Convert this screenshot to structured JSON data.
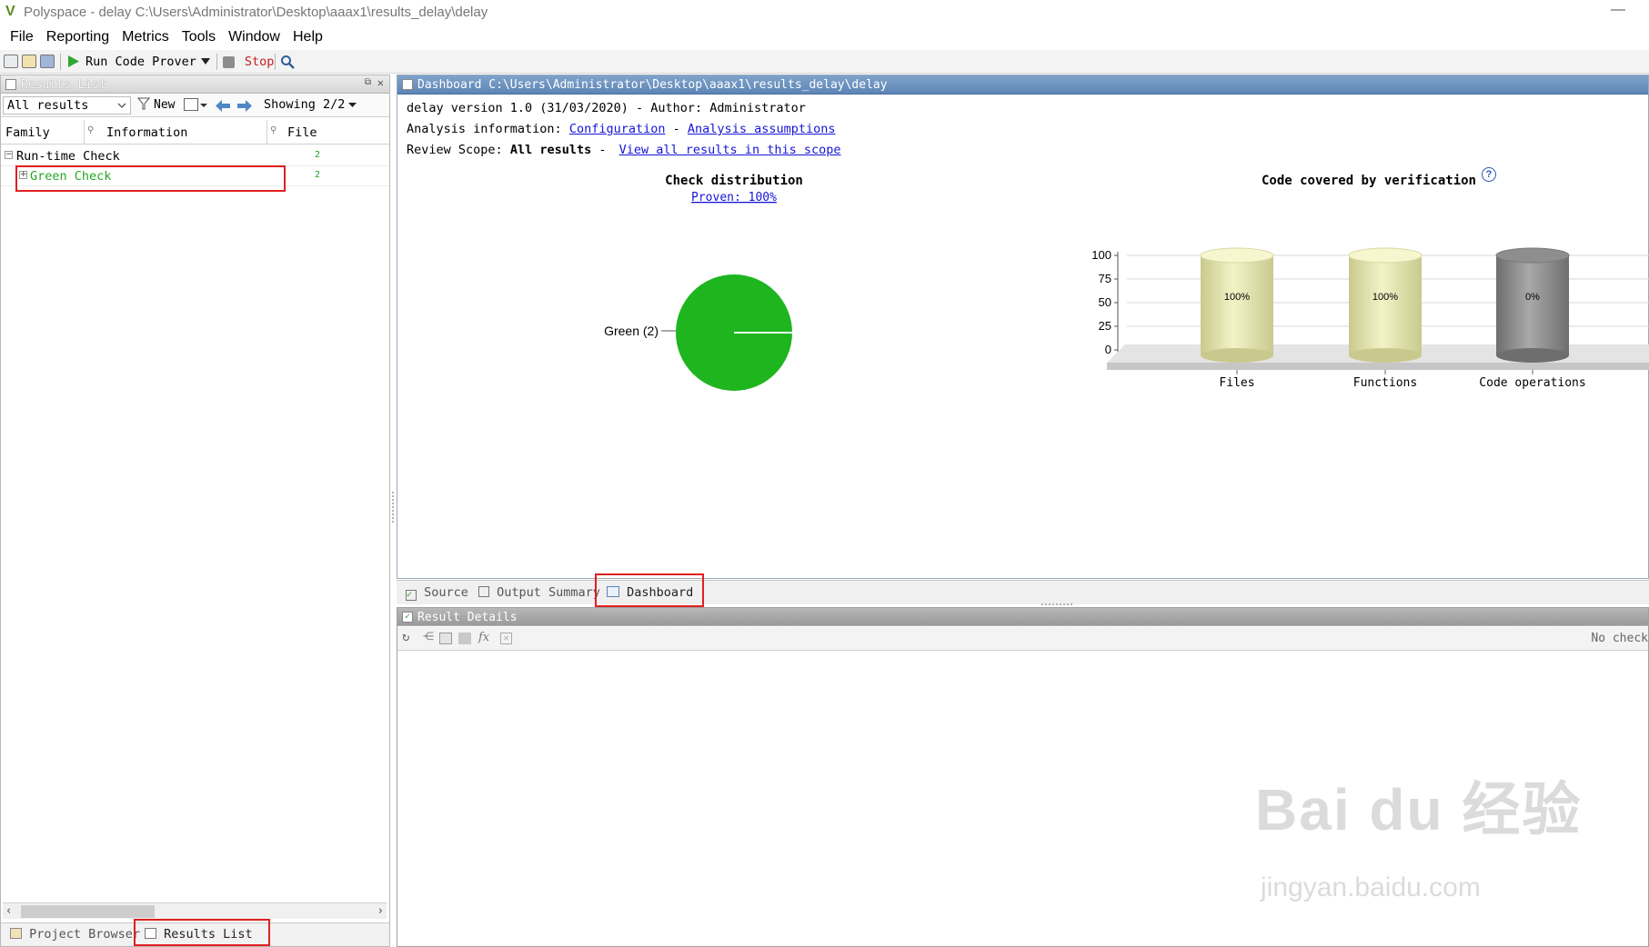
{
  "window": {
    "title": "Polyspace - delay C:\\Users\\Administrator\\Desktop\\aaax1\\results_delay\\delay",
    "logo": "V",
    "minimize": "—"
  },
  "menu": [
    "File",
    "Reporting",
    "Metrics",
    "Tools",
    "Window",
    "Help"
  ],
  "toolbar": {
    "run_label": "Run Code Prover",
    "stop_label": "Stop"
  },
  "results_list": {
    "title": "Results List",
    "filter": "All results",
    "new_label": "New",
    "showing": "Showing 2/2",
    "columns": [
      "Family",
      "Information",
      "File"
    ],
    "rows": [
      {
        "label": "Run-time Check",
        "count": "2",
        "expander": "−"
      },
      {
        "label": "Green Check",
        "count": "2",
        "expander": "+"
      }
    ],
    "bottom_tabs": [
      "Project Browser",
      "Results List"
    ]
  },
  "dashboard": {
    "title": "Dashboard C:\\Users\\Administrator\\Desktop\\aaax1\\results_delay\\delay",
    "version_line": "delay version 1.0 (31/03/2020) - Author: Administrator",
    "analysis_prefix": "Analysis information:",
    "analysis_link1": "Configuration",
    "analysis_sep": "-",
    "analysis_link2": "Analysis assumptions",
    "scope_prefix": "Review Scope:",
    "scope_value": "All results",
    "scope_sep": "-",
    "scope_link": "View all results in this scope",
    "help_icon": "?"
  },
  "view_tabs": [
    "Source",
    "Output Summary",
    "Dashboard"
  ],
  "result_details": {
    "title": "Result Details",
    "fx": "fx",
    "status": "No check"
  },
  "watermark": {
    "main": "Bai du 经验",
    "sub": "jingyan.baidu.com"
  },
  "chart_data": [
    {
      "type": "pie",
      "title": "Check distribution",
      "subtitle": "Proven: 100%",
      "slices": [
        {
          "label": "Green (2)",
          "value": 2,
          "color": "#1eb51e"
        }
      ]
    },
    {
      "type": "bar",
      "title": "Code covered by verification",
      "categories": [
        "Files",
        "Functions",
        "Code operations"
      ],
      "values": [
        100,
        100,
        0
      ],
      "data_labels": [
        "100%",
        "100%",
        "0%"
      ],
      "ylim": [
        0,
        100
      ],
      "yticks": [
        "100",
        "75",
        "50",
        "25",
        "0"
      ],
      "grid": true,
      "colors": [
        "#e6e6aa",
        "#e6e6aa",
        "#8a8a8a"
      ]
    }
  ]
}
